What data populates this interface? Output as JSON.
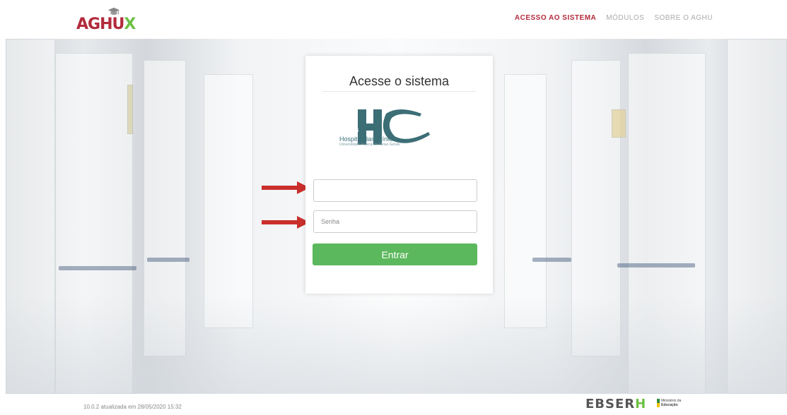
{
  "header": {
    "logo_text": "AGHU",
    "logo_accent": "X",
    "nav": [
      {
        "label": "ACESSO AO SISTEMA",
        "active": true
      },
      {
        "label": "MÓDULOS",
        "active": false
      },
      {
        "label": "SOBRE O AGHU",
        "active": false
      }
    ]
  },
  "login": {
    "title": "Acesse o sistema",
    "institution_logo": "HC UFMG Hospital das Clínicas",
    "institution_ufmg": "UFMG",
    "institution_name": "Hospital das Clínicas",
    "institution_subtitle": "Universidade Federal de Minas Gerais",
    "username": {
      "value": "",
      "placeholder": ""
    },
    "password": {
      "value": "",
      "placeholder": "Senha"
    },
    "submit_label": "Entrar"
  },
  "annotations": {
    "arrow_color": "#c9302c",
    "arrows": [
      "arrow-right-icon",
      "arrow-right-icon"
    ]
  },
  "footer": {
    "version": "10.0.2 atualizada em 28/05/2020 15:32",
    "ebserh_text": "EBSER",
    "ebserh_accent": "H",
    "ministry_line1": "Ministério da",
    "ministry_line2": "Educação"
  },
  "colors": {
    "brand_red": "#b22a3b",
    "brand_green": "#6cbf43",
    "button_green": "#5cb85c"
  }
}
